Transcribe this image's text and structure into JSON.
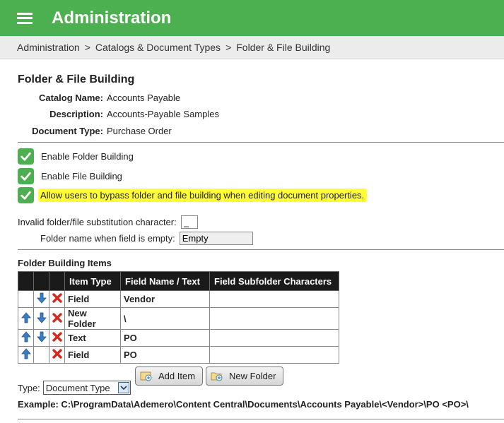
{
  "header": {
    "title": "Administration",
    "menu_icon": "hamburger-menu-icon"
  },
  "breadcrumb": [
    "Administration",
    "Catalogs & Document Types",
    "Folder & File Building"
  ],
  "breadcrumb_separator": ">",
  "page": {
    "title": "Folder & File Building",
    "info": [
      {
        "label": "Catalog Name:",
        "value": "Accounts Payable"
      },
      {
        "label": "Description:",
        "value": "Accounts-Payable Samples"
      },
      {
        "label": "Document Type:",
        "value": "Purchase Order"
      }
    ]
  },
  "options": [
    {
      "label": "Enable Folder Building",
      "checked": true
    },
    {
      "label": "Enable File Building",
      "checked": true
    },
    {
      "label": "Allow users to bypass folder and file building when editing document properties.",
      "checked": true,
      "highlighted": true
    }
  ],
  "settings": {
    "invalid_char_label": "Invalid folder/file substitution character:",
    "invalid_char_value": "_",
    "empty_field_label": "Folder name when field is empty:",
    "empty_field_value": "Empty"
  },
  "folder_items": {
    "title": "Folder Building Items",
    "columns": [
      "Item Type",
      "Field Name / Text",
      "Field Subfolder Characters"
    ],
    "rows": [
      {
        "item_type": "Field",
        "field_name": "Vendor",
        "subfolder_chars": "",
        "up": false,
        "down": true,
        "delete": true
      },
      {
        "item_type": "New Folder",
        "field_name": "\\",
        "subfolder_chars": "",
        "up": true,
        "down": true,
        "delete": true
      },
      {
        "item_type": "Text",
        "field_name": "PO",
        "subfolder_chars": "",
        "up": true,
        "down": true,
        "delete": true
      },
      {
        "item_type": "Field",
        "field_name": "PO",
        "subfolder_chars": "",
        "up": true,
        "down": false,
        "delete": true
      }
    ]
  },
  "add_controls": {
    "type_label": "Type:",
    "type_selected": "Document Type",
    "add_item_label": "Add Item",
    "new_folder_label": "New Folder"
  },
  "example": "Example: C:\\ProgramData\\Ademero\\Content Central\\Documents\\Accounts Payable\\<Vendor>\\PO <PO>\\",
  "colors": {
    "header_bg": "#4caf50",
    "check_bg": "#4caf50",
    "highlight": "#ffff33",
    "table_header_bg": "#1a1a1a"
  }
}
